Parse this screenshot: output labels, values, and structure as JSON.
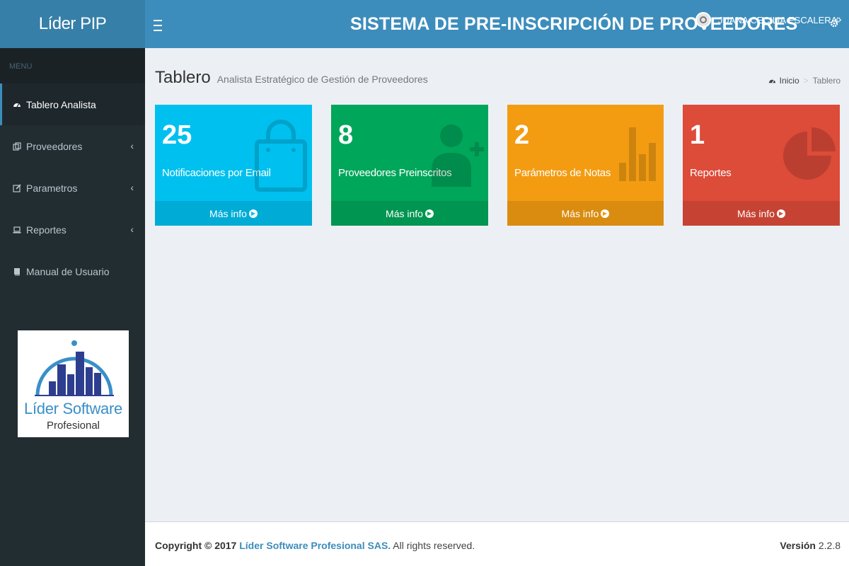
{
  "app": {
    "logo": "Líder PIP",
    "title": "SISTEMA DE PRE-INSCRIPCIÓN DE PROVEEDORES",
    "user_name": "JUANA CECILIA ESCALERA"
  },
  "sidebar": {
    "header": "MENU",
    "items": [
      {
        "label": "Tablero Analista",
        "icon": "dashboard-icon"
      },
      {
        "label": "Proveedores",
        "icon": "clone-icon"
      },
      {
        "label": "Parametros",
        "icon": "edit-icon"
      },
      {
        "label": "Reportes",
        "icon": "laptop-icon"
      },
      {
        "label": "Manual de Usuario",
        "icon": "book-icon"
      }
    ],
    "logo_text1": "Líder Software",
    "logo_text2": "Profesional"
  },
  "content": {
    "title": "Tablero",
    "subtitle": "Analista Estratégico de Gestión de Proveedores",
    "breadcrumb": [
      "Inicio",
      "Tablero"
    ]
  },
  "boxes": [
    {
      "number": "25",
      "label": "Notificaciones por Email",
      "footer": "Más info",
      "color": "#00c0ef",
      "icon": "shopping-bag-icon"
    },
    {
      "number": "8",
      "label": "Proveedores Preinscritos",
      "footer": "Más info",
      "color": "#00a65a",
      "icon": "user-plus-icon"
    },
    {
      "number": "2",
      "label": "Parámetros de Notas",
      "footer": "Más info",
      "color": "#f39c12",
      "icon": "bar-chart-icon"
    },
    {
      "number": "1",
      "label": "Reportes",
      "footer": "Más info",
      "color": "#dd4b39",
      "icon": "pie-chart-icon"
    }
  ],
  "footer": {
    "copyright": "Copyright © 2017",
    "company": "Líder Software Profesional SAS.",
    "rights": "All rights reserved.",
    "version_label": "Versión",
    "version": "2.2.8"
  }
}
